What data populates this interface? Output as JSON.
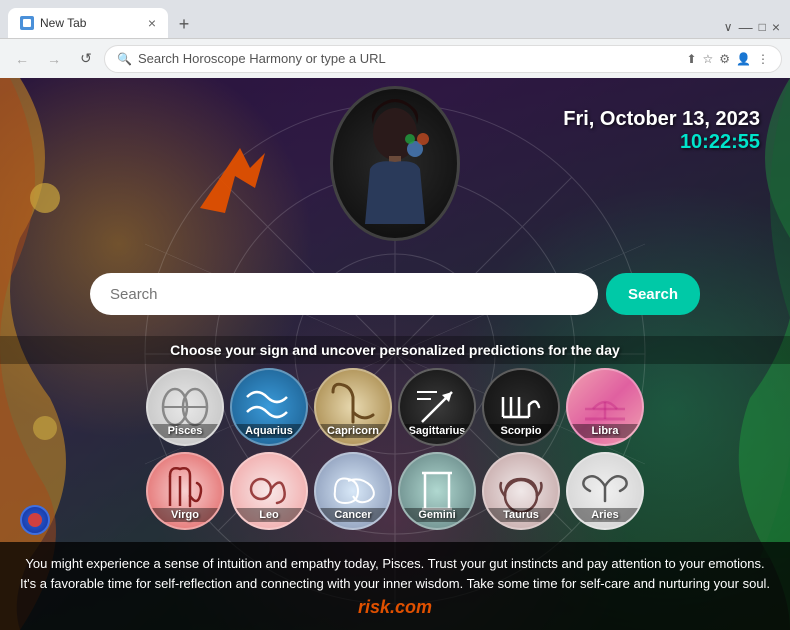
{
  "browser": {
    "tab": {
      "title": "New Tab",
      "close_label": "×",
      "new_tab_label": "+"
    },
    "nav": {
      "back_label": "←",
      "forward_label": "→",
      "refresh_label": "↺",
      "address_placeholder": "Search Horoscope Harmony or type a URL",
      "tab_bar_collapse": "∨",
      "tab_bar_minimize": "—",
      "tab_bar_maximize": "□",
      "tab_bar_close": "×"
    }
  },
  "page": {
    "date": "Fri, October 13, 2023",
    "time": "10:22:55",
    "search_placeholder": "Search",
    "search_button": "Search",
    "tagline": "Choose your sign and uncover personalized predictions for the day",
    "zodiac_row1": [
      {
        "name": "Pisces",
        "symbol": "♓",
        "class": "zc-pisces"
      },
      {
        "name": "Aquarius",
        "symbol": "♒",
        "class": "zc-aquarius"
      },
      {
        "name": "Capricorn",
        "symbol": "♑",
        "class": "zc-capricorn"
      },
      {
        "name": "Sagittarius",
        "symbol": "♐",
        "class": "zc-sagittarius"
      },
      {
        "name": "Scorpio",
        "symbol": "♏",
        "class": "zc-scorpio"
      },
      {
        "name": "Libra",
        "symbol": "♎",
        "class": "zc-libra"
      }
    ],
    "zodiac_row2": [
      {
        "name": "Virgo",
        "symbol": "♍",
        "class": "zc-virgo"
      },
      {
        "name": "Leo",
        "symbol": "♌",
        "class": "zc-leo"
      },
      {
        "name": "Cancer",
        "symbol": "♋",
        "class": "zc-cancer"
      },
      {
        "name": "Gemini",
        "symbol": "♊",
        "class": "zc-gemini"
      },
      {
        "name": "Taurus",
        "symbol": "♉",
        "class": "zc-taurus"
      },
      {
        "name": "Aries",
        "symbol": "♈",
        "class": "zc-aries"
      }
    ],
    "description": "You might experience a sense of intuition and empathy today, Pisces. Trust your gut instincts and pay attention to your emotions. It's a favorable time for self-reflection and connecting with your inner wisdom. Take some time for self-care and nurturing your soul.",
    "watermark": "risk.com"
  }
}
